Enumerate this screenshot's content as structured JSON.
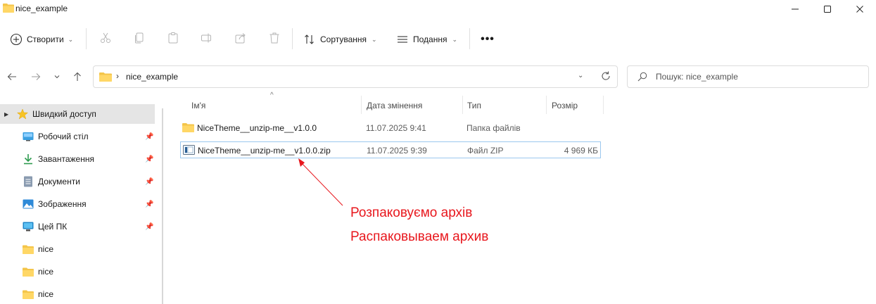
{
  "window": {
    "title": "nice_example"
  },
  "toolbar": {
    "new_label": "Створити",
    "sort_label": "Сортування",
    "view_label": "Подання",
    "more_label": "•••"
  },
  "address": {
    "path": "nice_example"
  },
  "search": {
    "placeholder": "Пошук: nice_example"
  },
  "sidebar": {
    "items": [
      {
        "label": "Швидкий доступ",
        "icon": "star-icon"
      },
      {
        "label": "Робочий стіл",
        "icon": "desktop-icon"
      },
      {
        "label": "Завантаження",
        "icon": "download-icon"
      },
      {
        "label": "Документи",
        "icon": "document-icon"
      },
      {
        "label": "Зображення",
        "icon": "pictures-icon"
      },
      {
        "label": "Цей ПК",
        "icon": "computer-icon"
      },
      {
        "label": "nice",
        "icon": "folder-icon"
      },
      {
        "label": "nice",
        "icon": "folder-icon"
      },
      {
        "label": "nice",
        "icon": "folder-icon"
      }
    ]
  },
  "columns": {
    "name": "Ім'я",
    "date": "Дата змінення",
    "type": "Тип",
    "size": "Розмір"
  },
  "files": [
    {
      "name": "NiceTheme__unzip-me__v1.0.0",
      "date": "11.07.2025 9:41",
      "type": "Папка файлів",
      "size": ""
    },
    {
      "name": "NiceTheme__unzip-me__v1.0.0.zip",
      "date": "11.07.2025 9:39",
      "type": "Файл ZIP",
      "size": "4 969 КБ"
    }
  ],
  "annotation": {
    "line1": "Розпаковуємо архів",
    "line2": "Распаковываем архив",
    "color": "#e8171d"
  },
  "colors": {
    "folder": "#f4c54a",
    "selection_border": "#9bc7ee",
    "accent": "#0067c0"
  }
}
